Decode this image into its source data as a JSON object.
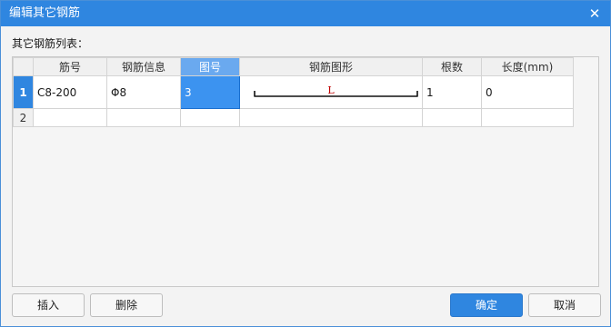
{
  "window": {
    "title": "编辑其它钢筋"
  },
  "list_label": "其它钢筋列表：",
  "table": {
    "headers": [
      "筋号",
      "钢筋信息",
      "图号",
      "钢筋图形",
      "根数",
      "长度(mm)"
    ],
    "active_header_index": 2,
    "rows": [
      {
        "num": "1",
        "bar_no": "C8-200",
        "bar_info": "Φ8",
        "figure_no": "3",
        "shape_label": "L",
        "count": "1",
        "length": "0"
      },
      {
        "num": "2",
        "bar_no": "",
        "bar_info": "",
        "figure_no": "",
        "shape_label": "",
        "count": "",
        "length": ""
      }
    ]
  },
  "buttons": {
    "insert": "插入",
    "delete": "删除",
    "ok": "确定",
    "cancel": "取消"
  },
  "colors": {
    "titlebar": "#2f86e0",
    "selection": "#3c93f0",
    "shape_label": "#c00000"
  }
}
